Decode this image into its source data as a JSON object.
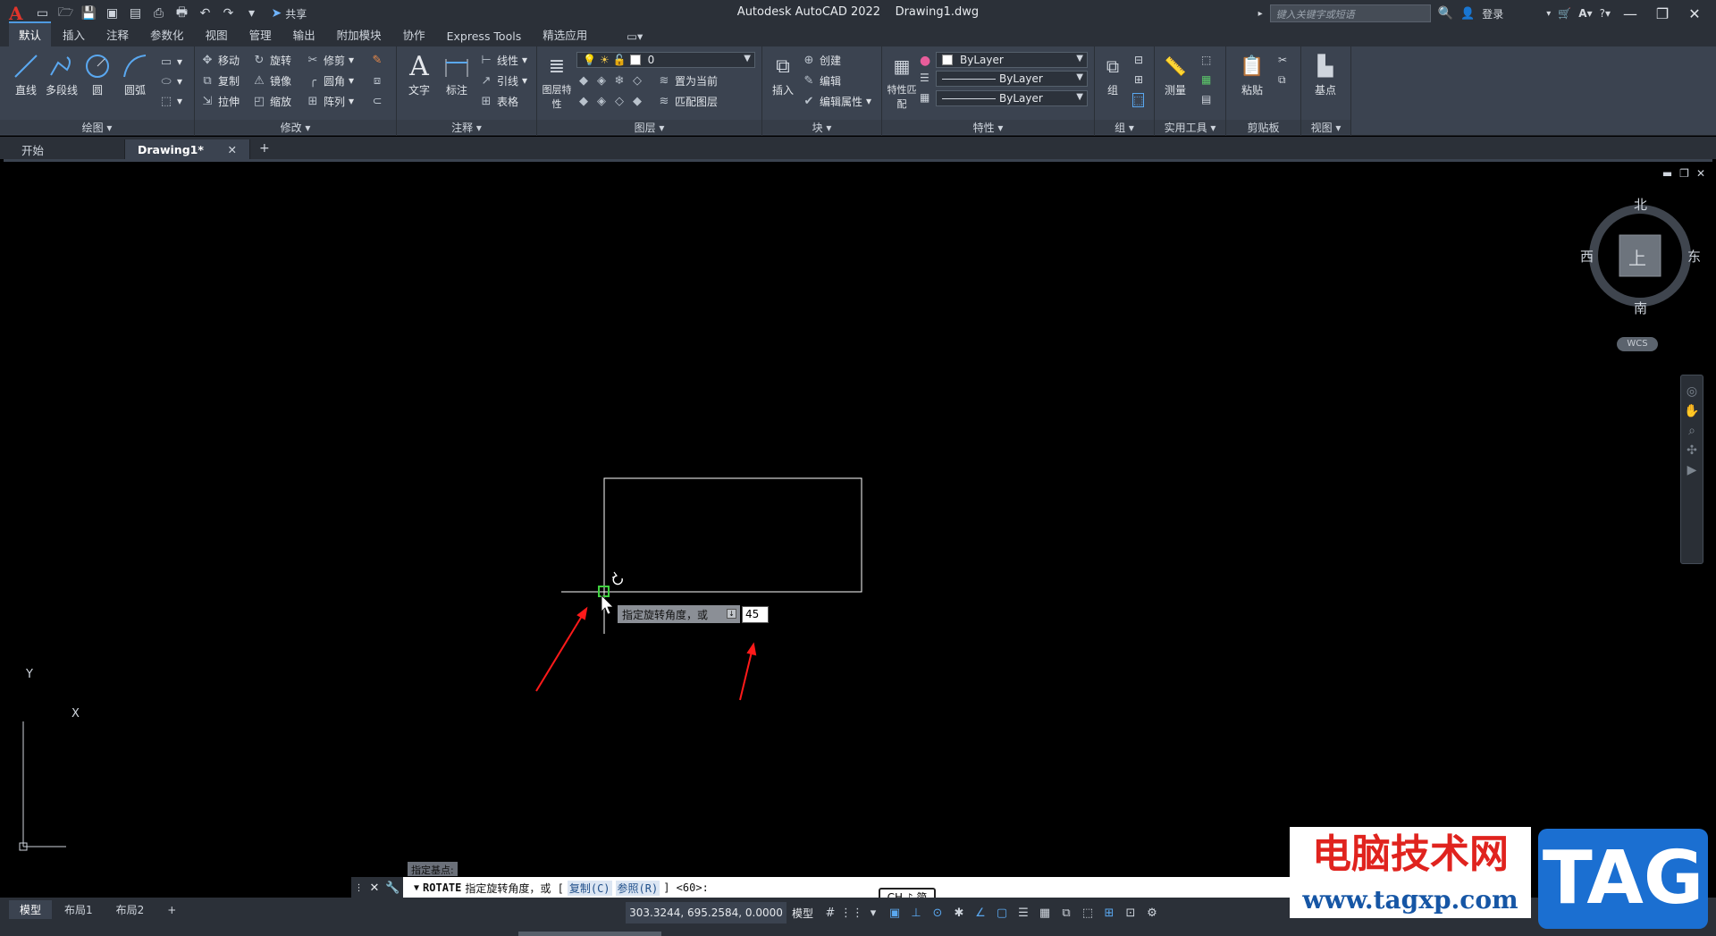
{
  "titlebar": {
    "app_title": "Autodesk AutoCAD 2022",
    "doc_title": "Drawing1.dwg",
    "share_label": "共享",
    "search_placeholder": "键入关键字或短语",
    "login_label": "登录"
  },
  "ribbon_tabs": [
    "默认",
    "插入",
    "注释",
    "参数化",
    "视图",
    "管理",
    "输出",
    "附加模块",
    "协作",
    "Express Tools",
    "精选应用"
  ],
  "ribbon": {
    "draw": {
      "label": "绘图",
      "line": "直线",
      "polyline": "多段线",
      "circle": "圆",
      "arc": "圆弧"
    },
    "modify": {
      "label": "修改",
      "move": "移动",
      "rotate": "旋转",
      "trim": "修剪",
      "copy": "复制",
      "mirror": "镜像",
      "fillet": "圆角",
      "stretch": "拉伸",
      "scale": "缩放",
      "array": "阵列"
    },
    "annotation": {
      "label": "注释",
      "text": "文字",
      "dimension": "标注",
      "linear": "线性",
      "leader": "引线",
      "table": "表格"
    },
    "layers": {
      "label": "图层",
      "layer_props": "图层特性",
      "current_layer": "0",
      "make_current": "置为当前",
      "match_layer": "匹配图层"
    },
    "block": {
      "label": "块",
      "insert": "插入",
      "create": "创建",
      "edit": "编辑",
      "edit_attr": "编辑属性"
    },
    "properties": {
      "label": "特性",
      "match": "特性匹配",
      "color": "ByLayer",
      "linetype": "ByLayer",
      "lineweight": "ByLayer"
    },
    "groups": {
      "label": "组",
      "group": "组"
    },
    "utilities": {
      "label": "实用工具",
      "measure": "测量"
    },
    "clipboard": {
      "label": "剪贴板",
      "paste": "粘贴"
    },
    "view": {
      "label": "视图",
      "base": "基点"
    }
  },
  "doc_tabs": {
    "start": "开始",
    "drawing": "Drawing1*"
  },
  "viewcube": {
    "north": "北",
    "south": "南",
    "east": "东",
    "west": "西",
    "face": "上",
    "wcs": "WCS"
  },
  "ucs": {
    "x": "X",
    "y": "Y"
  },
  "tooltip": {
    "prompt": "指定旋转角度，或",
    "angle_value": "45"
  },
  "command": {
    "history": "指定基点:",
    "name": "ROTATE",
    "prompt": "指定旋转角度，或 [",
    "opt_copy": "复制(C)",
    "opt_ref": "参照(R)",
    "suffix": "] <60>:"
  },
  "ime": {
    "label": "CH ♪ 简"
  },
  "statusbar": {
    "layouts": [
      "模型",
      "布局1",
      "布局2"
    ],
    "coords": "303.3244, 695.2584, 0.0000",
    "model_label": "模型"
  },
  "watermark": {
    "cn": "电脑技术网",
    "url": "www.tagxp.com",
    "tag": "TAG"
  }
}
